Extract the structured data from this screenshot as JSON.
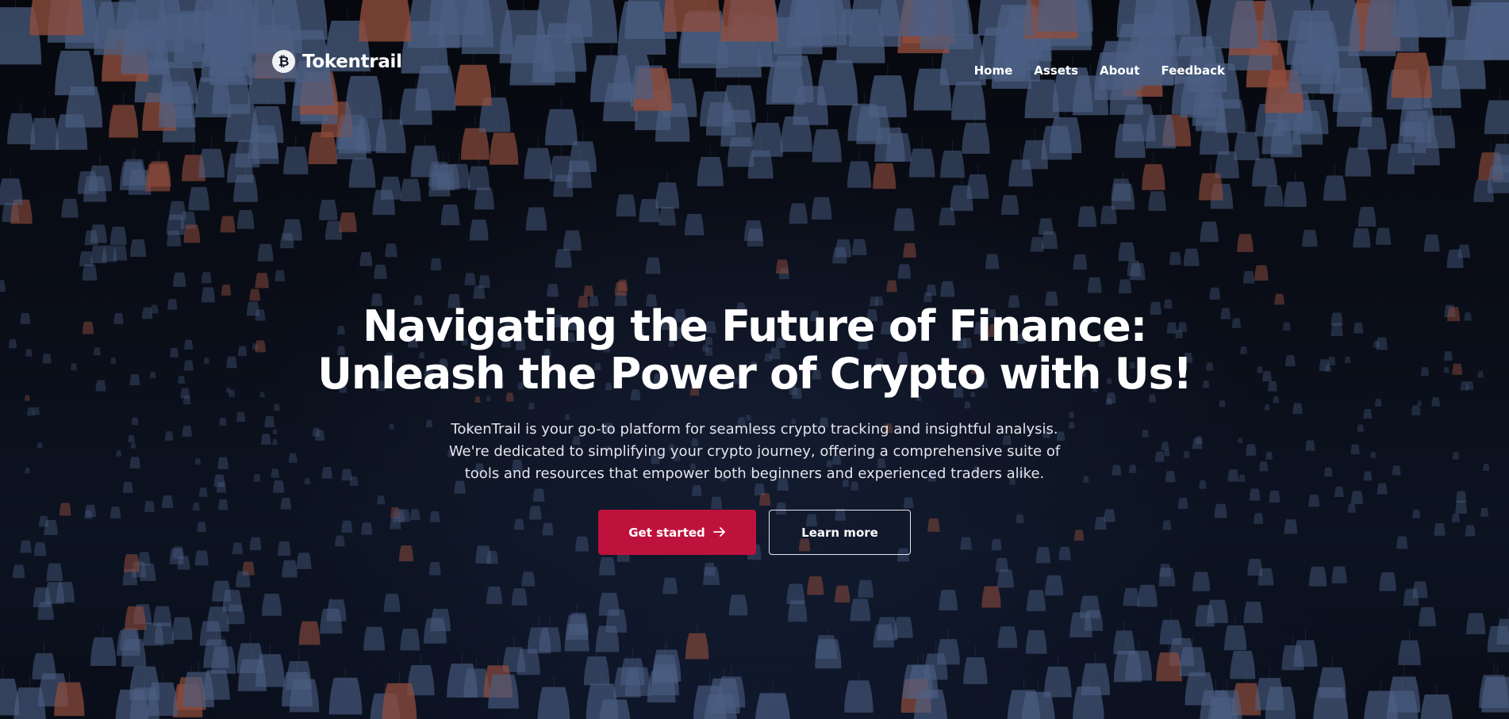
{
  "header": {
    "logo_icon": "bitcoin-icon",
    "brand": "Tokentrail",
    "nav": [
      {
        "label": "Home"
      },
      {
        "label": "Assets"
      },
      {
        "label": "About"
      },
      {
        "label": "Feedback"
      }
    ]
  },
  "hero": {
    "headline": "Navigating the Future of Finance: Unleash the Power of Crypto with Us!",
    "description": "TokenTrail is your go-to platform for seamless crypto tracking and insightful analysis. We're dedicated to simplifying your crypto journey, offering a comprehensive suite of tools and resources that empower both beginners and experienced traders alike.",
    "primary_button": {
      "label": "Get started",
      "icon": "arrow-right-icon"
    },
    "secondary_button": {
      "label": "Learn more"
    }
  },
  "colors": {
    "accent": "#be123c",
    "text": "#ffffff",
    "background": "#0d1220"
  }
}
